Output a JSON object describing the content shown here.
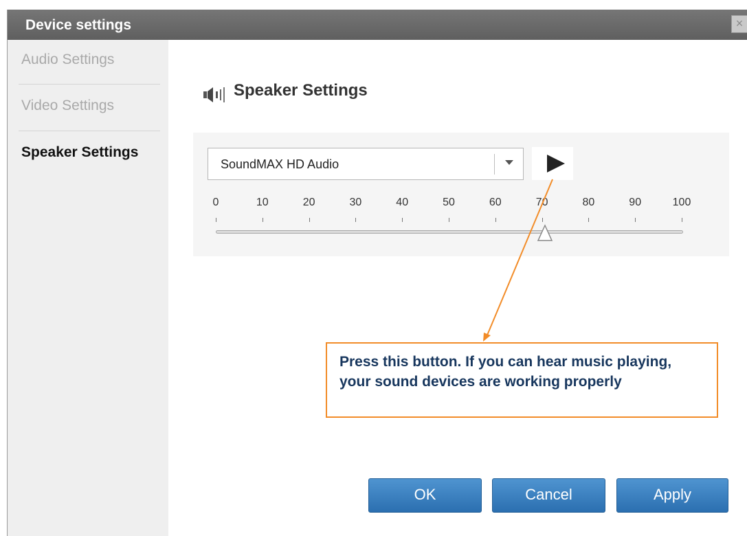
{
  "dialog": {
    "title": "Device settings",
    "close_label": "×"
  },
  "sidebar": {
    "items": [
      {
        "label": "Audio Settings",
        "active": false
      },
      {
        "label": "Video Settings",
        "active": false
      },
      {
        "label": "Speaker Settings",
        "active": true
      }
    ]
  },
  "speaker": {
    "heading": "Speaker Settings",
    "icon": "speaker-icon",
    "device_select": {
      "value": "SoundMAX HD Audio"
    },
    "play_icon": "play-icon",
    "volume": {
      "ticks": [
        "0",
        "10",
        "20",
        "30",
        "40",
        "50",
        "60",
        "70",
        "80",
        "90",
        "100"
      ],
      "value": 70
    }
  },
  "callout": {
    "text": "Press this button. If you can hear music playing, your sound devices are working properly",
    "border_color": "#f28c28",
    "text_color": "#17365d"
  },
  "buttons": {
    "ok": "OK",
    "cancel": "Cancel",
    "apply": "Apply"
  },
  "colors": {
    "titlebar": "#666666",
    "button": "#3a80c0",
    "sidebar": "#efefef"
  }
}
